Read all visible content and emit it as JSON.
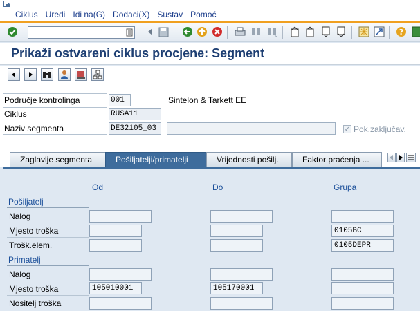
{
  "menu": {
    "items": [
      "Ciklus",
      "Uredi",
      "Idi na(G)",
      "Dodaci(X)",
      "Sustav",
      "Pomoć"
    ]
  },
  "toolbar": {
    "command_value": ""
  },
  "title": "Prikaži ostvareni ciklus procjene: Segment",
  "header": {
    "controlling_area_label": "Područje kontrolinga",
    "controlling_area_value": "001",
    "controlling_area_desc": "Sintelon & Tarkett EE",
    "cycle_label": "Ciklus",
    "cycle_value": "RUSA11",
    "segment_label": "Naziv segmenta",
    "segment_value": "DE32105_03",
    "segment_desc_value": "",
    "locked_label": "Pok.zaključav."
  },
  "tabs": [
    {
      "label": "Zaglavlje segmenta"
    },
    {
      "label": "Pošiljatelji/primatelji"
    },
    {
      "label": "Vrijednosti pošilj."
    },
    {
      "label": "Faktor praćenja ..."
    }
  ],
  "panel": {
    "col_from": "Od",
    "col_to": "Do",
    "col_group": "Grupa",
    "sender_title": "Pošiljatelj",
    "receiver_title": "Primatelj",
    "sender_rows": [
      {
        "label": "Nalog",
        "from": "",
        "to": "",
        "group": ""
      },
      {
        "label": "Mjesto troška",
        "from": "",
        "to": "",
        "group": "0105BC"
      },
      {
        "label": "Trošk.elem.",
        "from": "",
        "to": "",
        "group": "0105DEPR"
      }
    ],
    "receiver_rows": [
      {
        "label": "Nalog",
        "from": "",
        "to": "",
        "group": ""
      },
      {
        "label": "Mjesto troška",
        "from": "105010001",
        "to": "105170001",
        "group": ""
      },
      {
        "label": "Nositelj troška",
        "from": "",
        "to": "",
        "group": ""
      }
    ]
  }
}
